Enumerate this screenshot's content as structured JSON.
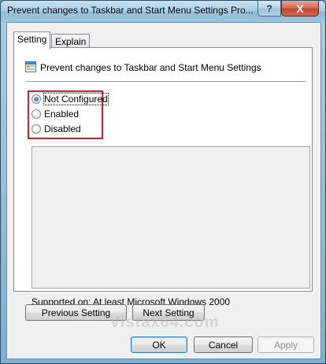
{
  "window": {
    "title": "Prevent changes to Taskbar and Start Menu Settings Pro..."
  },
  "titlebar_buttons": {
    "help_label": "?",
    "close_label": "X"
  },
  "tabs": [
    {
      "label": "Setting",
      "active": true
    },
    {
      "label": "Explain",
      "active": false
    }
  ],
  "policy": {
    "title": "Prevent changes to Taskbar and Start Menu Settings",
    "icon": "policy-setting-icon"
  },
  "options": [
    {
      "label": "Not Configured",
      "checked": true
    },
    {
      "label": "Enabled",
      "checked": false
    },
    {
      "label": "Disabled",
      "checked": false
    }
  ],
  "supported": {
    "label": "Supported on:",
    "value": "At least Microsoft Windows 2000"
  },
  "nav_buttons": {
    "previous": "Previous Setting",
    "next": "Next Setting"
  },
  "footer_buttons": {
    "ok": "OK",
    "cancel": "Cancel",
    "apply": "Apply"
  },
  "watermark": "Vistax64.com",
  "colors": {
    "highlight_box": "#c0272d",
    "title_bar": "#a5cbe2",
    "close_button": "#c04530"
  }
}
